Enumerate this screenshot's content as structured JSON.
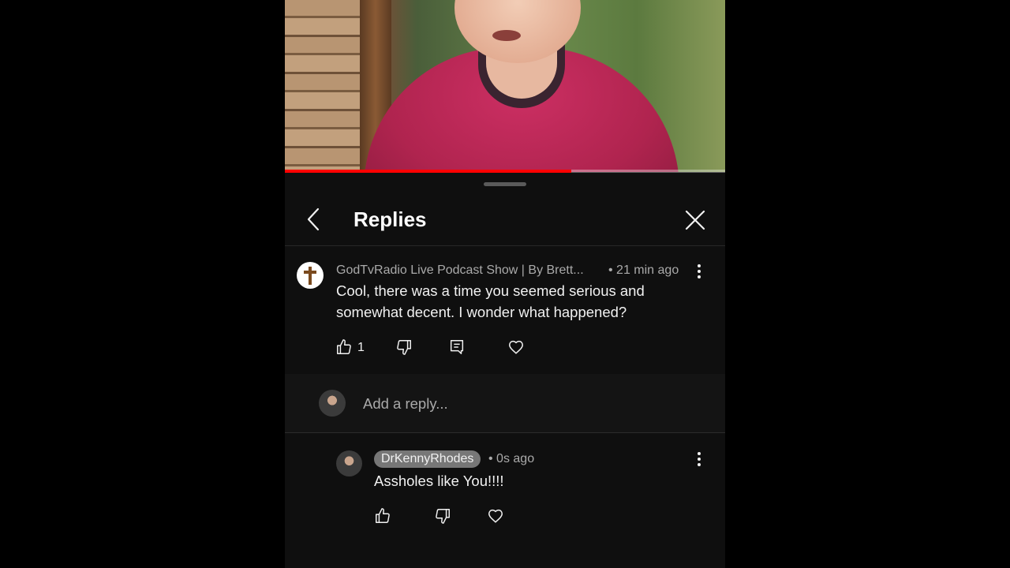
{
  "video": {
    "progress_fraction": 0.65
  },
  "panel": {
    "title": "Replies"
  },
  "parent_comment": {
    "author": "GodTvRadio Live Podcast Show | By Brett...",
    "time": "• 21 min ago",
    "text_line1": "Cool, there was a time you seemed serious and",
    "text_line2": "somewhat decent. I wonder what happened?",
    "like_count": "1"
  },
  "reply_input": {
    "placeholder": "Add a reply..."
  },
  "reply": {
    "author": "DrKennyRhodes",
    "time": "• 0s ago",
    "text": "Assholes like You!!!!"
  },
  "colors": {
    "background": "#0f0f0f",
    "progress": "#ff0000",
    "secondary_text": "#aaaaaa",
    "chip": "#777777"
  }
}
